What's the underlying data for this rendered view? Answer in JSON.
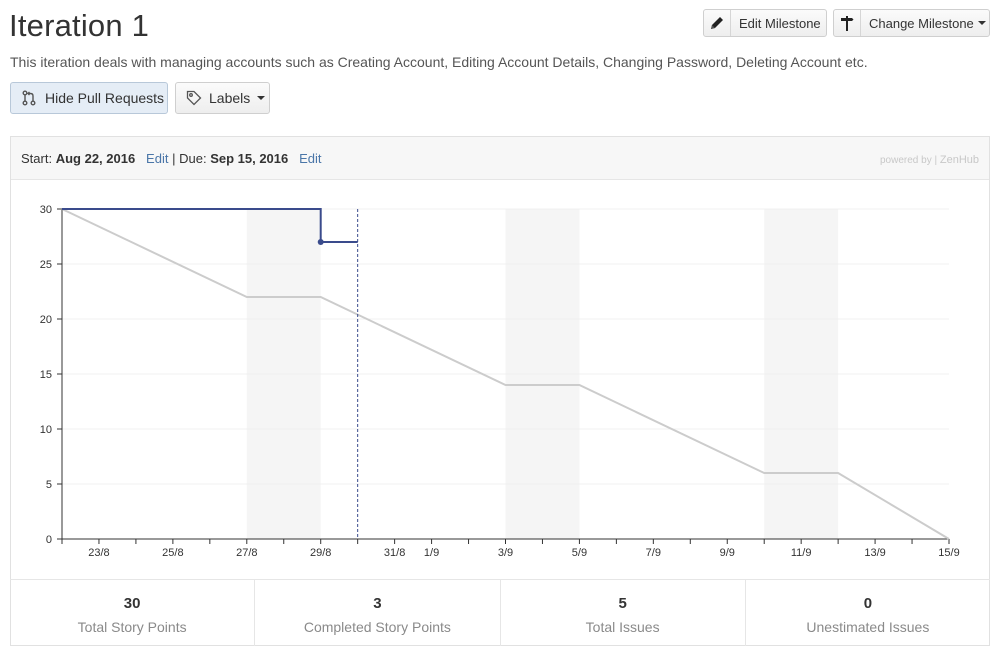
{
  "milestone": {
    "title": "Iteration 1",
    "description": "This iteration deals with managing accounts such as Creating Account, Editing Account Details, Changing Password, Deleting Account etc."
  },
  "toolbar": {
    "edit_milestone": "Edit Milestone",
    "change_milestone": "Change Milestone",
    "hide_pull_requests": "Hide Pull Requests",
    "labels": "Labels"
  },
  "dates": {
    "start_label": "Start:",
    "start": "Aug 22, 2016",
    "due_label": "Due:",
    "due": "Sep 15, 2016",
    "edit": "Edit",
    "separator": "|"
  },
  "powered_by": {
    "text": "powered by |",
    "brand": "ZenHub"
  },
  "chart_data": {
    "type": "line",
    "title": "",
    "xlabel": "",
    "ylabel": "",
    "x_ticks": [
      "23/8",
      "25/8",
      "27/8",
      "29/8",
      "31/8",
      "1/9",
      "3/9",
      "5/9",
      "7/9",
      "9/9",
      "11/9",
      "13/9",
      "15/9"
    ],
    "x_tick_dates": [
      "2016-08-23",
      "2016-08-25",
      "2016-08-27",
      "2016-08-29",
      "2016-08-31",
      "2016-09-01",
      "2016-09-03",
      "2016-09-05",
      "2016-09-07",
      "2016-09-09",
      "2016-09-11",
      "2016-09-13",
      "2016-09-15"
    ],
    "x_range": [
      "2016-08-22",
      "2016-09-15"
    ],
    "ylim": [
      0,
      30
    ],
    "y_ticks": [
      0,
      5,
      10,
      15,
      20,
      25,
      30
    ],
    "grid": true,
    "weekends": [
      [
        "2016-08-27",
        "2016-08-29"
      ],
      [
        "2016-09-03",
        "2016-09-05"
      ],
      [
        "2016-09-10",
        "2016-09-12"
      ]
    ],
    "today": "2016-08-30",
    "series": [
      {
        "color": "#cccccc",
        "points": [
          [
            "2016-08-22",
            30
          ],
          [
            "2016-08-27",
            22
          ],
          [
            "2016-08-29",
            22
          ],
          [
            "2016-09-03",
            14
          ],
          [
            "2016-09-05",
            14
          ],
          [
            "2016-09-10",
            6
          ],
          [
            "2016-09-12",
            6
          ],
          [
            "2016-09-15",
            0
          ]
        ]
      },
      {
        "color": "#3a4b8c",
        "step": true,
        "points": [
          [
            "2016-08-22",
            30
          ],
          [
            "2016-08-29",
            30
          ],
          [
            "2016-08-29",
            27
          ],
          [
            "2016-08-30",
            27
          ]
        ]
      }
    ]
  },
  "stats": [
    {
      "value": "30",
      "label": "Total Story Points"
    },
    {
      "value": "3",
      "label": "Completed Story Points"
    },
    {
      "value": "5",
      "label": "Total Issues"
    },
    {
      "value": "0",
      "label": "Unestimated Issues"
    }
  ]
}
